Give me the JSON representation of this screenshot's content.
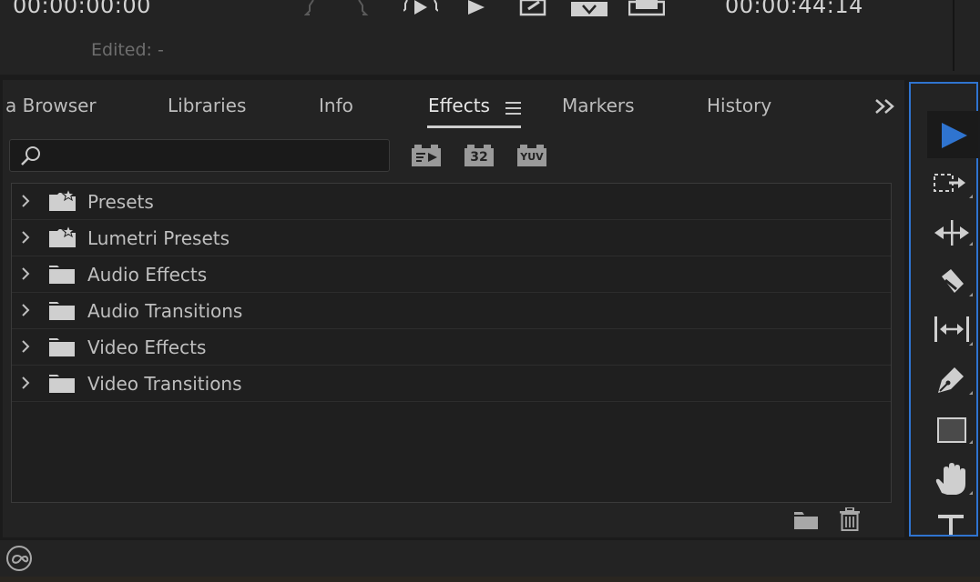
{
  "monitor": {
    "timecode_in": "00:00:00:00",
    "timecode_out": "00:00:44:14",
    "edited_label": "Edited: -"
  },
  "tabs": [
    {
      "label": "a Browser"
    },
    {
      "label": "Libraries"
    },
    {
      "label": "Info"
    },
    {
      "label": "Effects"
    },
    {
      "label": "Markers"
    },
    {
      "label": "History"
    }
  ],
  "effects": {
    "search_value": "",
    "toggle_32": "32",
    "toggle_yuv": "YUV",
    "folders": [
      {
        "label": "Presets",
        "icon": "preset-folder-icon"
      },
      {
        "label": "Lumetri Presets",
        "icon": "preset-folder-icon"
      },
      {
        "label": "Audio Effects",
        "icon": "folder-icon"
      },
      {
        "label": "Audio Transitions",
        "icon": "folder-icon"
      },
      {
        "label": "Video Effects",
        "icon": "folder-icon"
      },
      {
        "label": "Video Transitions",
        "icon": "folder-icon"
      }
    ]
  },
  "tools": [
    "selection-tool-icon",
    "track-select-forward-icon",
    "ripple-edit-icon",
    "razor-icon",
    "slip-icon",
    "pen-icon",
    "rectangle-icon",
    "hand-icon",
    "type-icon"
  ],
  "colors": {
    "accent": "#2f74d0",
    "panel": "#232323",
    "background": "#1b1b1b"
  }
}
